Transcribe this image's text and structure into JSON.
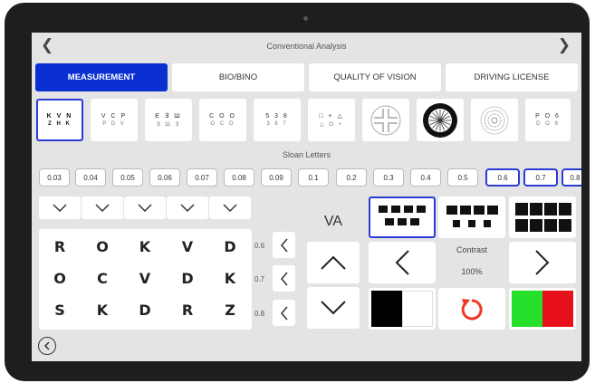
{
  "header": {
    "title": "Conventional Analysis",
    "back_icon": "chevron-left-icon",
    "forward_icon": "chevron-right-icon"
  },
  "tabs": [
    {
      "label": "MEASUREMENT",
      "active": true
    },
    {
      "label": "BIO/BINO",
      "active": false
    },
    {
      "label": "QUALITY OF VISION",
      "active": false
    },
    {
      "label": "DRIVING LICENSE",
      "active": false
    }
  ],
  "charts": [
    {
      "l1": "K V N",
      "l2": "Z H K",
      "selected": true
    },
    {
      "l1": "V C P",
      "l2": "P D V"
    },
    {
      "l1": "E ∃ Ш",
      "l2": "∃ Ш ∃"
    },
    {
      "l1": "C O O",
      "l2": "O C O"
    },
    {
      "l1": "5 3 8",
      "l2": "3 8 7"
    },
    {
      "l1": "□ + △",
      "l2": "△ O +"
    },
    {
      "icon": "cross-target-icon"
    },
    {
      "icon": "radial-target-icon"
    },
    {
      "icon": "concentric-target-icon"
    },
    {
      "l1": "P O 6",
      "l2": "D O 9"
    }
  ],
  "chart_type_label": "Sloan Letters",
  "va_values": [
    "0.03",
    "0.04",
    "0.05",
    "0.06",
    "0.07",
    "0.08",
    "0.09",
    "0.1",
    "0.2",
    "0.3",
    "0.4",
    "0.5",
    "0.6",
    "0.7",
    "0.8"
  ],
  "va_selected": [
    "0.6",
    "0.7",
    "0.8"
  ],
  "letters": [
    [
      "R",
      "O",
      "K",
      "V",
      "D"
    ],
    [
      "O",
      "C",
      "V",
      "D",
      "K"
    ],
    [
      "S",
      "K",
      "D",
      "R",
      "Z"
    ]
  ],
  "row_va": [
    "0.6",
    "0.7",
    "0.8"
  ],
  "va_label": "VA",
  "contrast_label": "Contrast",
  "contrast_value": "100%",
  "colors": {
    "accent": "#0a2fd0",
    "green": "#27e02c",
    "red": "#e8101a",
    "reset": "#ee3a2a"
  }
}
